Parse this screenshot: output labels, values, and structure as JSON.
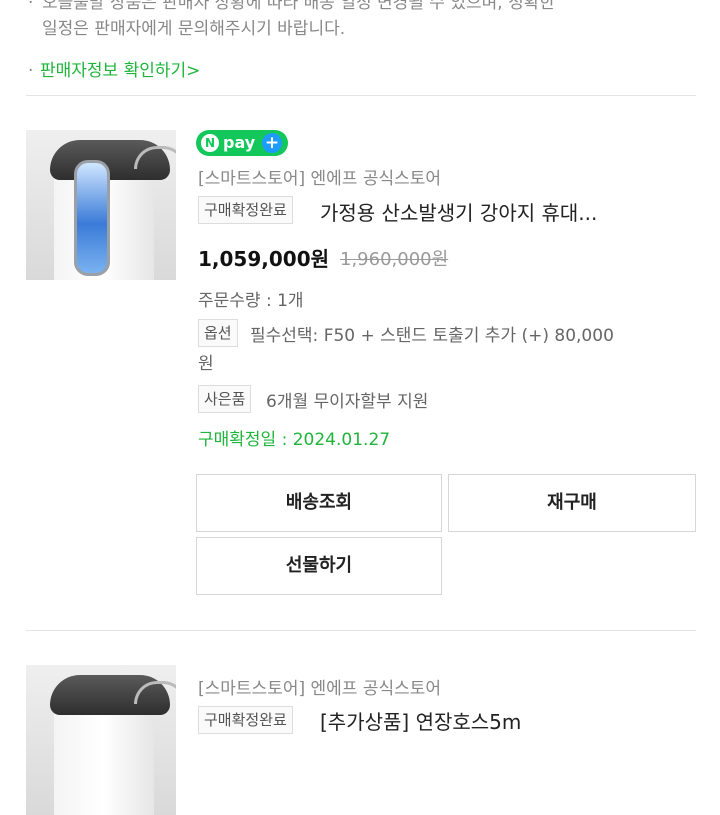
{
  "notice": {
    "line1": "오늘출발 상품은 판매자 상황에 따라 배송 일정 변경될 수 있으며, 정확한",
    "line2": "일정은 판매자에게 문의해주시기 바랍니다.",
    "bullet": "·",
    "link": "판매자정보 확인하기",
    "link_chevron": ">"
  },
  "orders": [
    {
      "badge": {
        "n": "N",
        "text": "pay",
        "plus": "+"
      },
      "store": "[스마트스토어] 엔에프 공식스토어",
      "status_tag": "구매확정완료",
      "product_name": "가정용 산소발생기 강아지 휴대...",
      "price": "1,059,000원",
      "original_price": "1,960,000원",
      "quantity": "주문수량 : 1개",
      "option_tag": "옵션",
      "option_line1": "필수선택: F50 + 스탠드 토출기 추가 (+) 80,000",
      "option_line2": "원",
      "gift_tag": "사은품",
      "gift_text": "6개월 무이자할부 지원",
      "confirm_date": "구매확정일 : 2024.01.27",
      "buttons": {
        "track": "배송조회",
        "rebuy": "재구매",
        "gift": "선물하기"
      }
    },
    {
      "store": "[스마트스토어] 엔에프 공식스토어",
      "status_tag": "구매확정완료",
      "product_name": "[추가상품] 연장호스5m"
    }
  ],
  "icons": {
    "thumbnail": "product-thumbnail",
    "chevron": "chevron-right-icon"
  },
  "colors": {
    "accent_green": "#1fb53b",
    "npay_green": "#13c75a",
    "npay_blue": "#1e9bff"
  }
}
